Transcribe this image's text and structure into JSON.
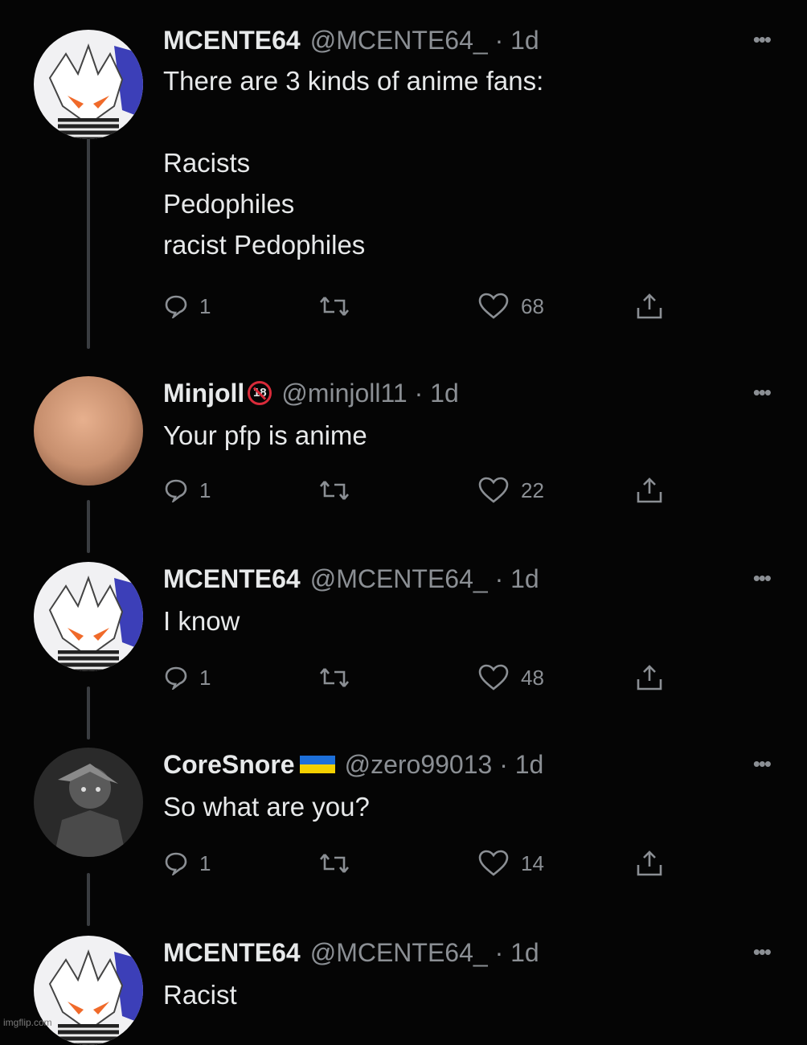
{
  "tweets": [
    {
      "display_name": "MCENTE64",
      "handle": "@MCENTE64_ · 1d",
      "text": "There are 3 kinds of anime fans:\n\nRacists\nPedophiles\nracist Pedophiles",
      "replies": "1",
      "likes": "68",
      "avatar": "anime-character-avatar"
    },
    {
      "display_name": "Minjoll",
      "badge": "18",
      "handle": "@minjoll11 · 1d",
      "text": "Your pfp is anime",
      "replies": "1",
      "likes": "22",
      "avatar": "peach-circle-avatar"
    },
    {
      "display_name": "MCENTE64",
      "handle": "@MCENTE64_ · 1d",
      "text": "I know",
      "replies": "1",
      "likes": "48",
      "avatar": "anime-character-avatar"
    },
    {
      "display_name": "CoreSnore",
      "flag": "ukraine-flag",
      "handle": "@zero99013 · 1d",
      "text": "So what are you?",
      "replies": "1",
      "likes": "14",
      "avatar": "grayscale-character-avatar"
    },
    {
      "display_name": "MCENTE64",
      "handle": "@MCENTE64_ · 1d",
      "text": "Racist",
      "avatar": "anime-character-avatar"
    }
  ],
  "more_label": "•••",
  "watermark": "imgflip.com",
  "colors": {
    "background": "#050505",
    "text": "#e7e9ea",
    "muted": "#8b8f94",
    "thread_line": "#3a3d41"
  }
}
